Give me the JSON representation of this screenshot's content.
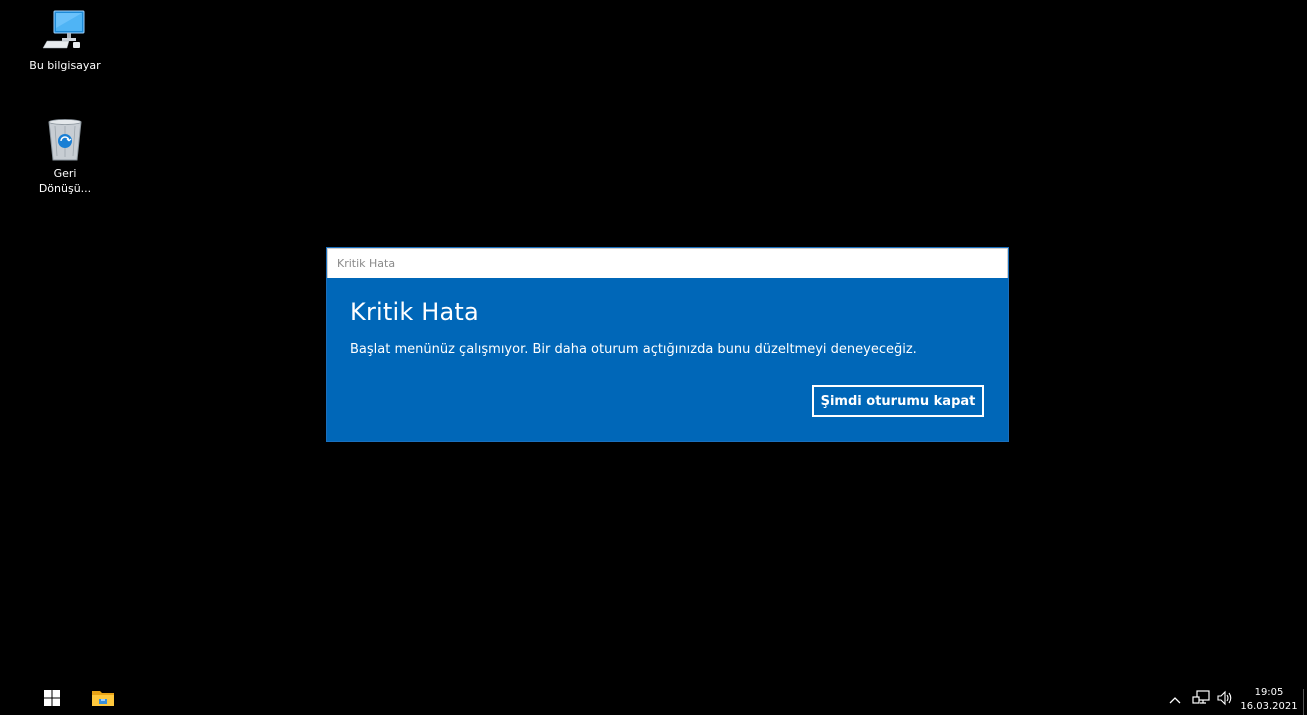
{
  "desktop": {
    "icons": [
      {
        "label": "Bu bilgisayar",
        "icon": "computer-icon"
      },
      {
        "label": "Geri Dönüşü...",
        "icon": "recycle-bin-icon"
      }
    ]
  },
  "dialog": {
    "window_title": "Kritik Hata",
    "heading": "Kritik Hata",
    "message": "Başlat menünüz çalışmıyor. Bir daha oturum açtığınızda bunu düzeltmeyi deneyeceğiz.",
    "button_label": "Şimdi oturumu kapat",
    "colors": {
      "background": "#0067b8",
      "text": "#ffffff",
      "titlebar": "#ffffff"
    }
  },
  "taskbar": {
    "start_icon": "windows-logo-icon",
    "pinned": [
      {
        "icon": "file-explorer-icon"
      }
    ],
    "tray": {
      "chevron_icon": "chevron-up-icon",
      "network_icon": "network-icon",
      "volume_icon": "volume-icon",
      "time": "19:05",
      "date": "16.03.2021"
    }
  }
}
